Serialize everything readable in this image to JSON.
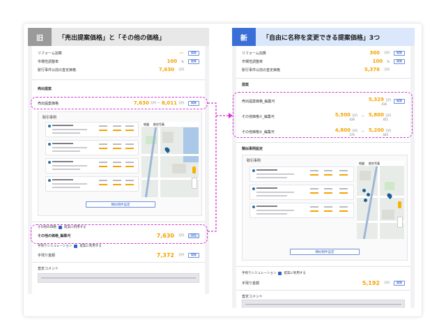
{
  "left": {
    "tag": "旧",
    "title": "「売出提案価格」と「その他の価格」",
    "rows_top": [
      {
        "label": "リフォーム加算",
        "value": "",
        "unit": "",
        "btn": "編集"
      },
      {
        "label": "市場性調整率",
        "value": "100",
        "unit": "%",
        "btn": "編集"
      },
      {
        "label": "駅行事件以前の査定価格",
        "value": "7,630",
        "unit": "万円",
        "btn": ""
      }
    ],
    "section_proposal": "売出提案",
    "proposal_row": {
      "label": "売出提案価格",
      "value1": "7,630",
      "unit1": "万円",
      "sep": "～",
      "value2": "8,011",
      "unit2": "万円",
      "btn": "編集"
    },
    "cases_label": "取引事例",
    "map_tab1": "地図",
    "map_tab2": "航空写真",
    "center_button": "類似物件設定",
    "other_price_label": "その他の価格",
    "other_price_check": "提案に利用する",
    "other_price_row": {
      "label": "その他の価格_編集可",
      "value": "7,630",
      "unit": "万円",
      "btn": "設定"
    },
    "sim_label": "手残りシミュレーション",
    "sim_check": "提案に利用する",
    "net_row": {
      "label": "手残り金額",
      "value": "7,372",
      "unit": "万円",
      "btn": "編集"
    },
    "comment_label": "査定コメント"
  },
  "right": {
    "tag": "新",
    "title": "「自由に名称を変更できる提案価格」3つ",
    "rows_top": [
      {
        "label": "リフォーム加算",
        "value": "300",
        "unit": "万円",
        "btn": "編集"
      },
      {
        "label": "市場性調整率",
        "value": "100",
        "unit": "%",
        "btn": "編集"
      },
      {
        "label": "駅行事件以前の査定価格",
        "value": "5,376",
        "unit": "万円",
        "btn": ""
      }
    ],
    "section_proposal": "提案",
    "proposal_rows": [
      {
        "label": "売出提案価格_編集可",
        "value": "5,329",
        "unit": "万円",
        "sub": "416",
        "btn": "編集"
      },
      {
        "label": "その他価格①_編集可",
        "value": "5,500",
        "unit": "万円",
        "sub": "428",
        "value2": "5,800",
        "unit2": "万円",
        "sub2": "451"
      },
      {
        "label": "その他価格②_編集可",
        "value": "4,800",
        "unit": "万円",
        "sub": "374",
        "value2": "5,200",
        "unit2": "万円",
        "sub2": "405"
      }
    ],
    "cases_section": "類似事例設定",
    "cases_label": "取引事例",
    "map_tab1": "地図",
    "map_tab2": "航空写真",
    "center_button": "類似物件設定",
    "sim_label": "手残りシミュレーション",
    "sim_check": "提案に利用する",
    "net_row": {
      "label": "手残り金額",
      "value": "5,192",
      "unit": "万円",
      "btn": "編集"
    },
    "comment_label": "査定コメント"
  },
  "colors": {
    "old_tag": "#9a9a9a",
    "new_tag": "#3b6fd8",
    "new_bar": "#dbe8fb",
    "old_bar": "#e8e8e8",
    "accent": "#f5a200",
    "dash": "#d62fd6"
  }
}
